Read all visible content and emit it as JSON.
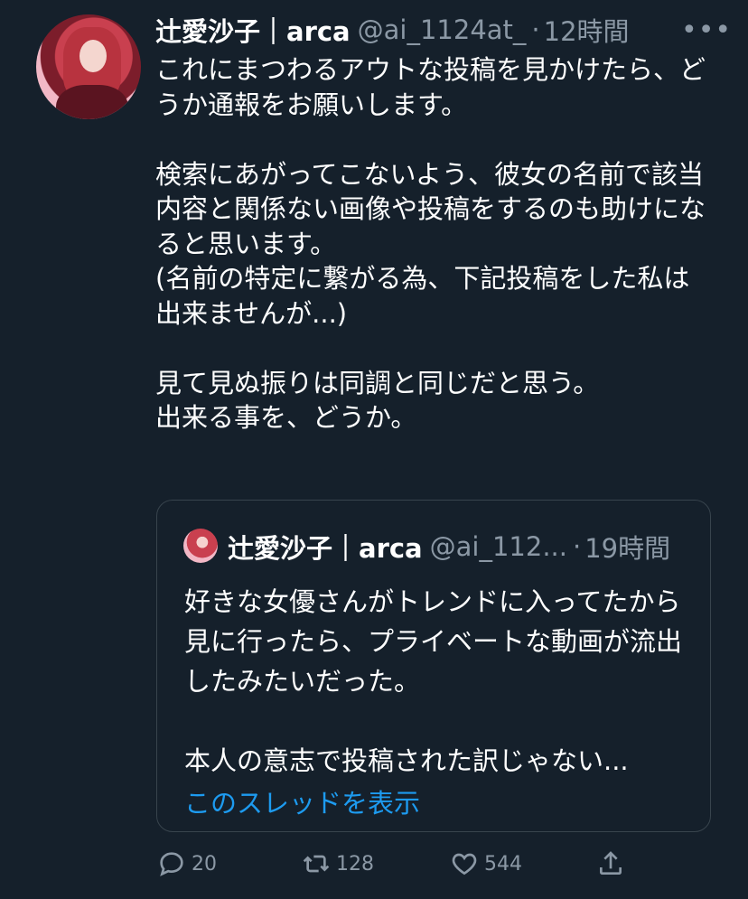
{
  "tweet": {
    "display_name": "辻愛沙子｜arca",
    "handle": "@ai_1124at_",
    "separator": "·",
    "time": "12時間",
    "more_icon": "•••",
    "text": "これにまつわるアウトな投稿を見かけたら、どうか通報をお願いします。\n\n検索にあがってこないよう、彼女の名前で該当内容と関係ない画像や投稿をするのも助けになると思います。\n(名前の特定に繋がる為、下記投稿をした私は出来ませんが...)\n\n見て見ぬ振りは同調と同じだと思う。\n出来る事を、どうか。"
  },
  "quoted": {
    "display_name": "辻愛沙子｜arca",
    "handle": "@ai_112...",
    "separator": "·",
    "time": "19時間",
    "text": "好きな女優さんがトレンドに入ってたから見に行ったら、プライベートな動画が流出したみたいだった。\n\n本人の意志で投稿された訳じゃない...",
    "show_thread": "このスレッドを表示"
  },
  "actions": {
    "reply_count": "20",
    "retweet_count": "128",
    "like_count": "544"
  },
  "colors": {
    "background": "#15202b",
    "secondary_text": "#8b98a5",
    "link": "#1d9bf0",
    "border": "#38444d"
  }
}
